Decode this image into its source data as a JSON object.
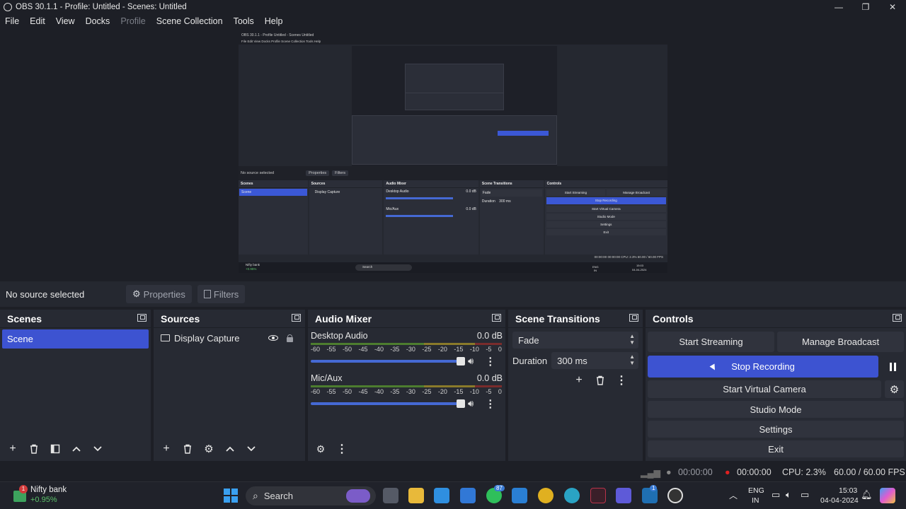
{
  "window": {
    "title": "OBS 30.1.1 - Profile: Untitled - Scenes: Untitled"
  },
  "menu": [
    "File",
    "Edit",
    "View",
    "Docks",
    "Profile",
    "Scene Collection",
    "Tools",
    "Help"
  ],
  "source_bar": {
    "no_source": "No source selected",
    "properties": "Properties",
    "filters": "Filters"
  },
  "scenes": {
    "title": "Scenes",
    "items": [
      "Scene"
    ]
  },
  "sources": {
    "title": "Sources",
    "items": [
      "Display Capture"
    ]
  },
  "audio_mixer": {
    "title": "Audio Mixer",
    "channels": [
      {
        "name": "Desktop Audio",
        "db": "0.0 dB"
      },
      {
        "name": "Mic/Aux",
        "db": "0.0 dB"
      }
    ],
    "scale": [
      "-60",
      "-55",
      "-50",
      "-45",
      "-40",
      "-35",
      "-30",
      "-25",
      "-20",
      "-15",
      "-10",
      "-5",
      "0"
    ]
  },
  "scene_transitions": {
    "title": "Scene Transitions",
    "transition": "Fade",
    "duration_label": "Duration",
    "duration_value": "300 ms"
  },
  "controls": {
    "title": "Controls",
    "start_streaming": "Start Streaming",
    "manage_broadcast": "Manage Broadcast",
    "stop_recording": "Stop Recording",
    "start_virtual_camera": "Start Virtual Camera",
    "studio_mode": "Studio Mode",
    "settings": "Settings",
    "exit": "Exit"
  },
  "status": {
    "stream_time": "00:00:00",
    "rec_time": "00:00:00",
    "cpu": "CPU: 2.3%",
    "fps": "60.00 / 60.00 FPS"
  },
  "taskbar": {
    "stock_name": "Nifty bank",
    "stock_change": "+0.95%",
    "stock_badge": "1",
    "search": "Search",
    "whatsapp_badge": "87",
    "linkedin_badge": "1",
    "lang1": "ENG",
    "lang2": "IN",
    "time": "15:03",
    "date": "04-04-2024"
  },
  "preview": {
    "title": "OBS 30.1.1 - Profile Untitled - Scenes Untitled",
    "menu": "File  Edit  View  Docks  Profile  Scene Collection  Tools  Help",
    "no_source": "No source selected",
    "properties": "Properties",
    "filters": "Filters",
    "scenes": "Scenes",
    "scene": "Scene",
    "sources": "Sources",
    "display_capture": "Display Capture",
    "audio_mixer": "Audio Mixer",
    "desktop_audio": "Desktop Audio",
    "mic_aux": "Mic/Aux",
    "db": "0.0 dB",
    "scene_transitions": "Scene Transitions",
    "fade": "Fade",
    "duration": "Duration",
    "duration_value": "300 ms",
    "controls": "Controls",
    "start_streaming": "Start Streaming",
    "manage_broadcast": "Manage Broadcast",
    "stop_recording": "Stop Recording",
    "start_virtual_camera": "Start Virtual Camera",
    "studio_mode": "Studio Mode",
    "settings": "Settings",
    "exit": "Exit",
    "status": "00:00:00   00:00:00   CPU: 2.3%   60.00 / 60.00 FPS",
    "stock": "Nifty bank",
    "stock_change": "+0.95%",
    "search": "Search",
    "time": "15:03",
    "date": "04-04-2024",
    "lang1": "ENG",
    "lang2": "IN"
  },
  "colors": {
    "accent": "#3d53d1",
    "record": "#e02020",
    "panel": "#272a33",
    "background": "#1d1f26"
  }
}
